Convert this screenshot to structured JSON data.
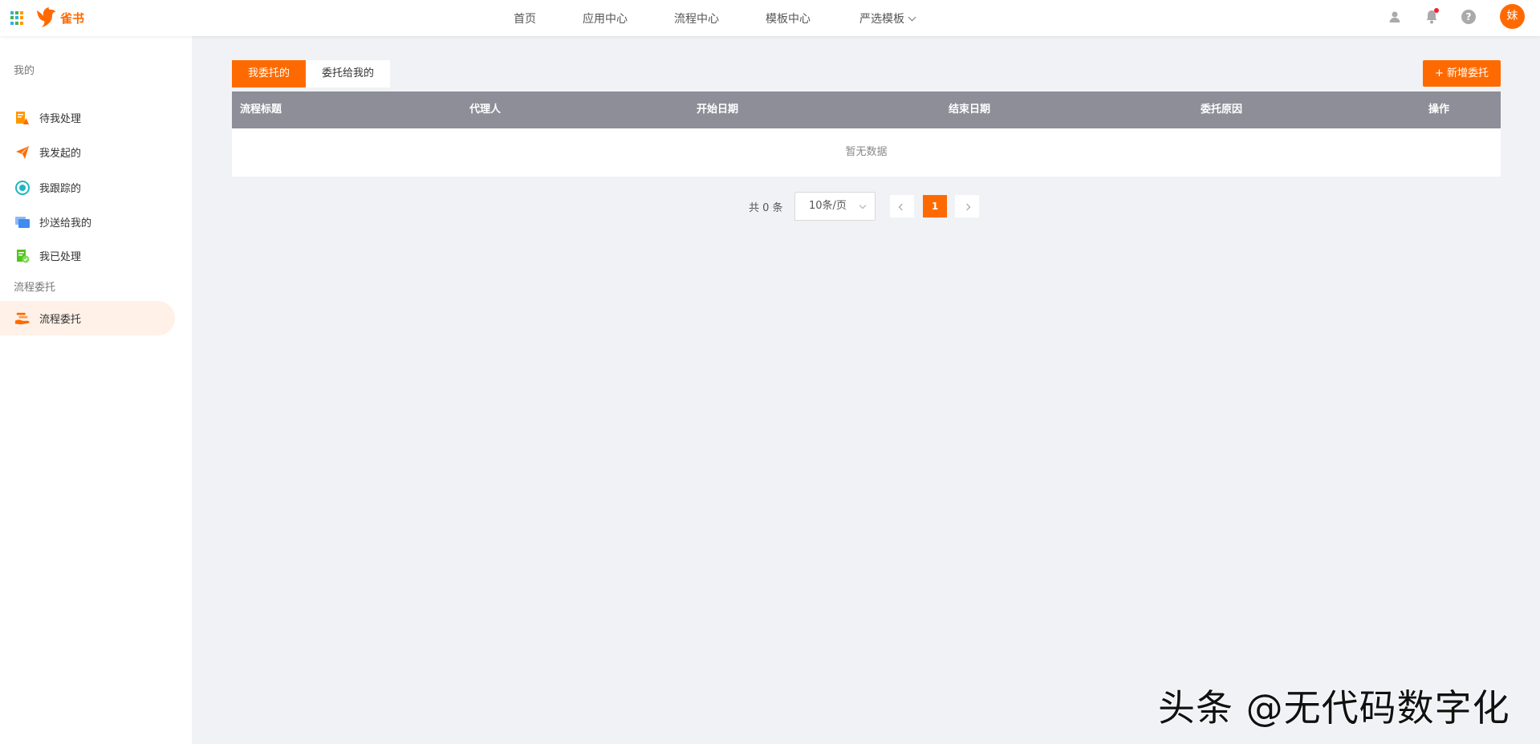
{
  "app": {
    "name": "雀书",
    "brand_color": "#ff6a00"
  },
  "topnav": {
    "items": [
      {
        "label": "首页"
      },
      {
        "label": "应用中心"
      },
      {
        "label": "流程中心"
      },
      {
        "label": "模板中心"
      },
      {
        "label": "严选模板",
        "dropdown": true
      }
    ],
    "icons": [
      "user-icon",
      "bell-icon",
      "help-icon"
    ],
    "avatar_text": "妹"
  },
  "sidebar": {
    "groups": [
      {
        "title": "我的",
        "items": [
          {
            "label": "待我处理",
            "icon": "pending-task-icon",
            "color": "#ff9800"
          },
          {
            "label": "我发起的",
            "icon": "paper-plane-icon",
            "color": "#ff6a00"
          },
          {
            "label": "我跟踪的",
            "icon": "target-icon",
            "color": "#1fb6c1"
          },
          {
            "label": "抄送给我的",
            "icon": "copy-icon",
            "color": "#3f8cf0"
          },
          {
            "label": "我已处理",
            "icon": "done-document-icon",
            "color": "#52c41a"
          }
        ]
      },
      {
        "title": "流程委托",
        "items": [
          {
            "label": "流程委托",
            "icon": "hand-delegate-icon",
            "color": "#ff6a00",
            "active": true
          }
        ]
      }
    ]
  },
  "main": {
    "tabs": [
      {
        "label": "我委托的",
        "active": true
      },
      {
        "label": "委托给我的",
        "active": false
      }
    ],
    "add_button": "新增委托",
    "table": {
      "columns": [
        "流程标题",
        "代理人",
        "开始日期",
        "结束日期",
        "委托原因",
        "操作"
      ],
      "rows": [],
      "empty_text": "暂无数据",
      "header_color": "#8e8e98"
    },
    "pagination": {
      "total_text": "共 0 条",
      "page_size": "10条/页",
      "current_page": "1"
    }
  },
  "watermark": "头条 @无代码数字化"
}
